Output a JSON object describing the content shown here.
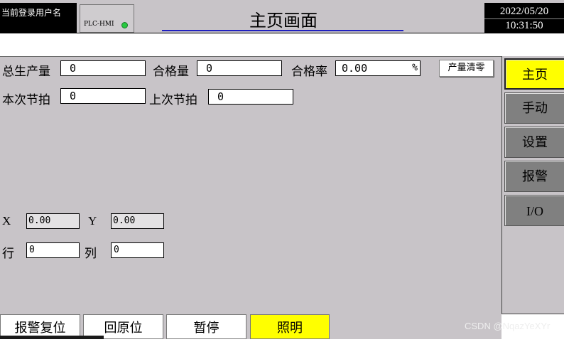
{
  "header": {
    "user_label": "当前登录用户名",
    "plc_label": "PLC-HMI",
    "page_title": "主页画面",
    "date": "2022/05/20",
    "time": "10:31:50",
    "status_color": "#27c93f"
  },
  "counters": {
    "total_label": "总生产量",
    "total_value": "0",
    "good_label": "合格量",
    "good_value": "0",
    "rate_label": "合格率",
    "rate_value": "0.00",
    "rate_unit": "%",
    "clear_button": "产量清零"
  },
  "cycle": {
    "current_label": "本次节拍",
    "current_value": "0",
    "last_label": "上次节拍",
    "last_value": "0"
  },
  "position": {
    "x_label": "X",
    "x_value": "0.00",
    "y_label": "Y",
    "y_value": "0.00",
    "row_label": "行",
    "row_value": "0",
    "col_label": "列",
    "col_value": "0"
  },
  "nav": {
    "home": "主页",
    "manual": "手动",
    "settings": "设置",
    "alarm": "报警",
    "io": "I/O",
    "active_color": "#ffff00"
  },
  "bottom": {
    "alarm_reset": "报警复位",
    "home_return": "回原位",
    "pause": "暂停",
    "lighting": "照明"
  },
  "watermark": "CSDN @NqazYeXYr"
}
